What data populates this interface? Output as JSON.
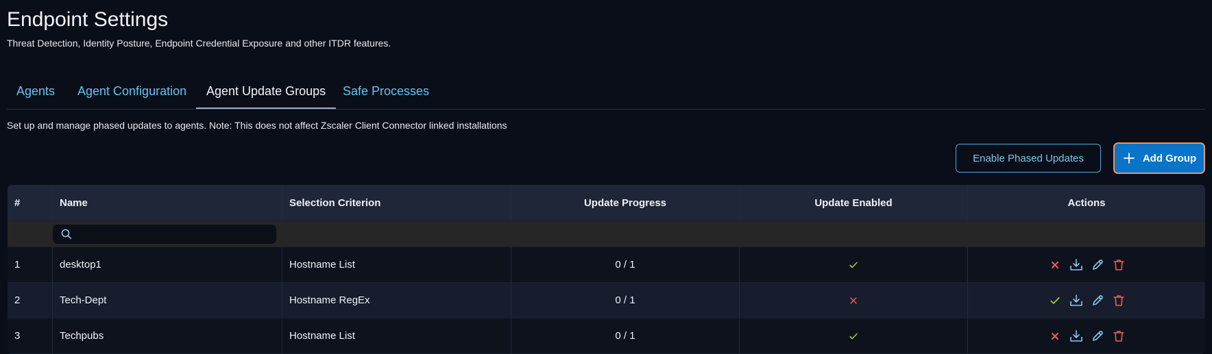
{
  "header": {
    "title": "Endpoint Settings",
    "subtitle": "Threat Detection, Identity Posture, Endpoint Credential Exposure and other ITDR features."
  },
  "tabs": [
    {
      "label": "Agents",
      "active": false
    },
    {
      "label": "Agent Configuration",
      "active": false
    },
    {
      "label": "Agent Update Groups",
      "active": true
    },
    {
      "label": "Safe Processes",
      "active": false
    }
  ],
  "description": "Set up and manage phased updates to agents. Note: This does not affect Zscaler Client Connector linked installations",
  "toolbar": {
    "enable_phased_label": "Enable Phased Updates",
    "add_group_label": "Add Group"
  },
  "table": {
    "columns": [
      "#",
      "Name",
      "Selection Criterion",
      "Update Progress",
      "Update Enabled",
      "Actions"
    ],
    "search_placeholder": "",
    "rows": [
      {
        "index": "1",
        "name": "desktop1",
        "criterion": "Hostname List",
        "progress": "0 / 1",
        "enabled": true
      },
      {
        "index": "2",
        "name": "Tech-Dept",
        "criterion": "Hostname RegEx",
        "progress": "0 / 1",
        "enabled": false
      },
      {
        "index": "3",
        "name": "Techpubs",
        "criterion": "Hostname List",
        "progress": "0 / 1",
        "enabled": true
      }
    ]
  },
  "colors": {
    "background": "#0a0e18",
    "accent": "#0a74c9",
    "link": "#66c3f0",
    "check": "#9ccc3a",
    "cross": "#f05a5a",
    "download": "#8cc8f0"
  },
  "icons": [
    "plus-icon",
    "search-icon",
    "check-icon",
    "x-icon",
    "download-icon",
    "pencil-icon",
    "trash-icon"
  ]
}
